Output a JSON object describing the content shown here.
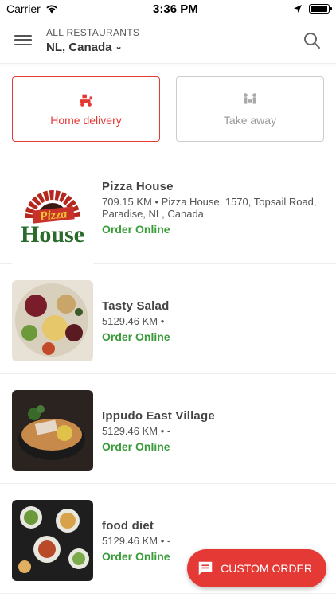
{
  "status": {
    "carrier": "Carrier",
    "time": "3:36 PM",
    "battery_level": 0.95
  },
  "header": {
    "subtitle": "ALL RESTAURANTS",
    "location": "NL, Canada"
  },
  "toggle": {
    "home_delivery": "Home delivery",
    "take_away": "Take away",
    "selected": "home_delivery",
    "accent_color": "#e53935"
  },
  "restaurants": [
    {
      "name": "Pizza House",
      "address": "709.15 KM • Pizza House, 1570, Topsail Road, Paradise, NL, Canada",
      "order": "Order Online",
      "logo_top": "Pizza",
      "logo_bottom": "House"
    },
    {
      "name": "Tasty Salad",
      "address": "5129.46 KM • -",
      "order": "Order Online"
    },
    {
      "name": "Ippudo East Village",
      "address": "5129.46 KM • -",
      "order": "Order Online"
    },
    {
      "name": "food diet",
      "address": "5129.46 KM • -",
      "order": "Order Online"
    }
  ],
  "fab": {
    "label": "CUSTOM ORDER",
    "color": "#e53935"
  },
  "colors": {
    "order_green": "#3a9b3a"
  }
}
